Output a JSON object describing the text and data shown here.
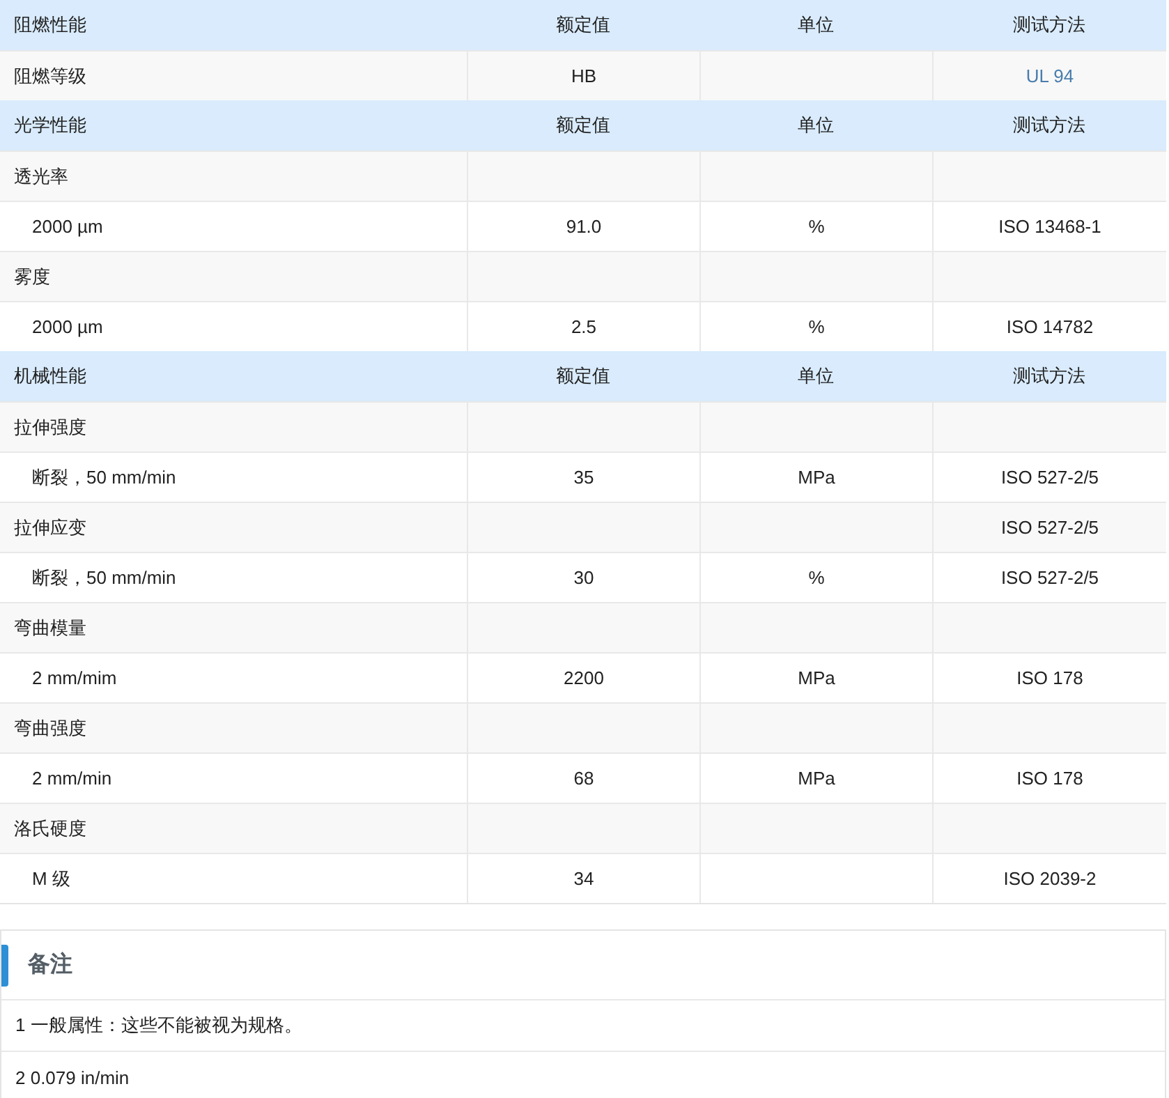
{
  "table": {
    "rows": [
      {
        "kind": "header",
        "property": "阻燃性能",
        "value": "额定值",
        "unit": "单位",
        "method": "测试方法"
      },
      {
        "kind": "property",
        "property": "阻燃等级",
        "value": "HB",
        "unit": "",
        "method": "UL 94",
        "method_link": true
      },
      {
        "kind": "header",
        "property": "光学性能",
        "value": "额定值",
        "unit": "单位",
        "method": "测试方法"
      },
      {
        "kind": "property",
        "property": "透光率",
        "value": "",
        "unit": "",
        "method": ""
      },
      {
        "kind": "sub",
        "property": "2000 µm",
        "value": "91.0",
        "unit": "%",
        "method": "ISO 13468-1"
      },
      {
        "kind": "property",
        "property": "雾度",
        "value": "",
        "unit": "",
        "method": ""
      },
      {
        "kind": "sub",
        "property": "2000 µm",
        "value": "2.5",
        "unit": "%",
        "method": "ISO 14782"
      },
      {
        "kind": "header",
        "property": "机械性能",
        "value": "额定值",
        "unit": "单位",
        "method": "测试方法"
      },
      {
        "kind": "property",
        "property": "拉伸强度",
        "value": "",
        "unit": "",
        "method": ""
      },
      {
        "kind": "sub",
        "property": "断裂，50 mm/min",
        "value": "35",
        "unit": "MPa",
        "method": "ISO 527-2/5"
      },
      {
        "kind": "property",
        "property": "拉伸应变",
        "value": "",
        "unit": "",
        "method": "ISO 527-2/5"
      },
      {
        "kind": "sub",
        "property": "断裂，50 mm/min",
        "value": "30",
        "unit": "%",
        "method": "ISO 527-2/5"
      },
      {
        "kind": "property",
        "property": "弯曲模量",
        "value": "",
        "unit": "",
        "method": ""
      },
      {
        "kind": "sub",
        "property": "2 mm/mim",
        "value": "2200",
        "unit": "MPa",
        "method": "ISO 178"
      },
      {
        "kind": "property",
        "property": "弯曲强度",
        "value": "",
        "unit": "",
        "method": ""
      },
      {
        "kind": "sub",
        "property": "2 mm/min",
        "value": "68",
        "unit": "MPa",
        "method": "ISO 178"
      },
      {
        "kind": "property",
        "property": "洛氏硬度",
        "value": "",
        "unit": "",
        "method": ""
      },
      {
        "kind": "sub",
        "property": "M 级",
        "value": "34",
        "unit": "",
        "method": "ISO 2039-2"
      }
    ]
  },
  "notes": {
    "title": "备注",
    "items": [
      "1 一般属性：这些不能被视为规格。",
      "2 0.079 in/min"
    ]
  }
}
